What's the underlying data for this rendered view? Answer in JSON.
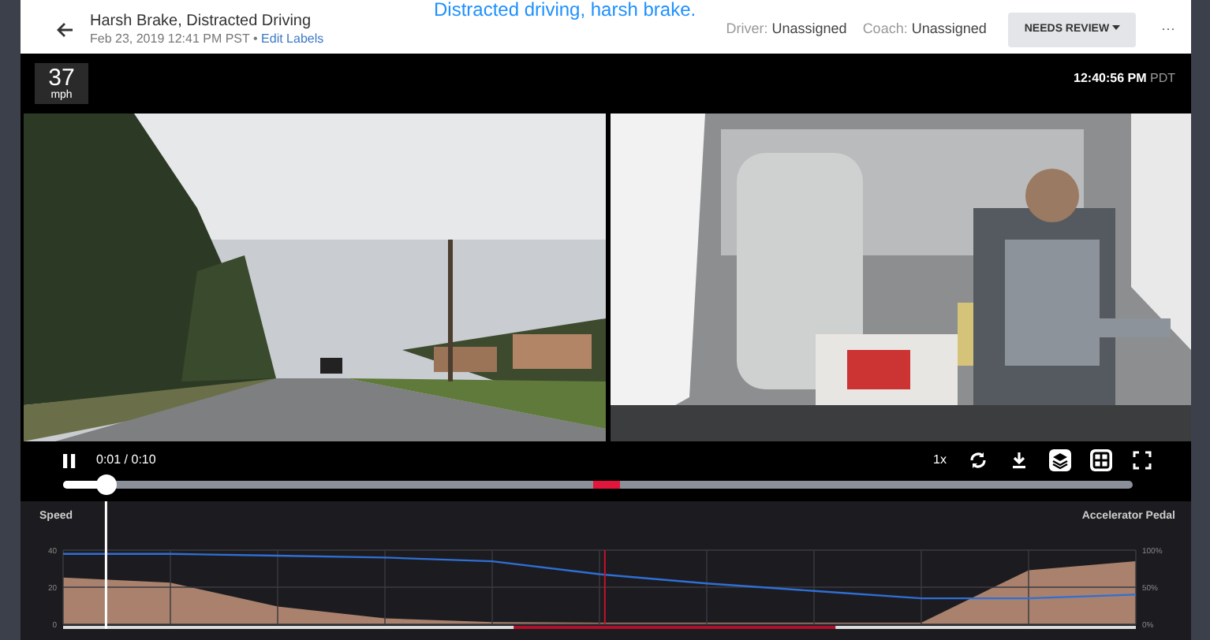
{
  "caption": "Distracted driving, harsh brake.",
  "header": {
    "title": "Harsh Brake, Distracted Driving",
    "subtitle": "Feb 23, 2019 12:41 PM PST",
    "separator": "•",
    "link": "Edit Labels",
    "meta": [
      {
        "label": "Driver:",
        "value": "Unassigned"
      },
      {
        "label": "Coach:",
        "value": "Unassigned"
      }
    ],
    "status_button": "NEEDS REVIEW",
    "more": "···"
  },
  "video": {
    "speed": "37",
    "speed_unit": "mph",
    "clock": "12:40:56 PM",
    "timezone": "PDT",
    "time": "0:01 / 0:10",
    "playback_rate": "1x",
    "level": 0.04,
    "toolbar": [
      {
        "kind": "loop",
        "selected": false
      },
      {
        "kind": "download",
        "selected": false
      },
      {
        "kind": "layers",
        "selected": true
      },
      {
        "kind": "grid",
        "selected": true
      },
      {
        "kind": "fullscreen",
        "selected": false
      }
    ]
  },
  "charts": [
    {
      "chart_data": {
        "type": "line",
        "categories": [
          null,
          null,
          null,
          null,
          null,
          null,
          null,
          null,
          null,
          null,
          null
        ],
        "ylim": [
          0,
          40
        ],
        "yticks": [
          0,
          20,
          40
        ],
        "grid": true,
        "series": [
          {
            "name": "Speed",
            "color": "#2f6fd6",
            "values": [
              38,
              38,
              37,
              36,
              34,
              27,
              22,
              18,
              14,
              14,
              16
            ]
          }
        ]
      }
    },
    {
      "chart_data": {
        "type": "area",
        "categories": [
          null,
          null,
          null,
          null,
          null,
          null,
          null,
          null,
          null,
          null,
          null
        ],
        "ylim": [
          0,
          100
        ],
        "yticks": [
          {
            "value": 0,
            "label": "0%"
          },
          {
            "value": 50,
            "label": "50%"
          },
          {
            "value": 100,
            "label": "100%"
          }
        ],
        "series": [
          {
            "name": "Accelerator Pedal",
            "color": "#a9816c",
            "values": [
              63,
              56,
              24,
              8,
              3,
              2,
              2,
              2,
              2,
              73,
              85
            ]
          }
        ]
      }
    }
  ]
}
